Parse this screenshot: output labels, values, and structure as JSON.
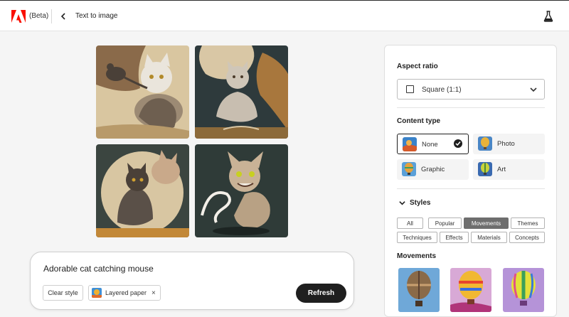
{
  "header": {
    "beta": "(Beta)",
    "breadcrumb": "Text to image",
    "brand_color": "#fa0f00"
  },
  "grid": {
    "images": [
      "cat-mouse-1",
      "cat-mouse-2",
      "cat-mouse-3",
      "cat-mouse-4"
    ]
  },
  "prompt": {
    "text": "Adorable cat catching mouse",
    "clear_label": "Clear style",
    "chip_label": "Layered paper",
    "chip_remove": "×",
    "refresh_label": "Refresh"
  },
  "panel": {
    "aspect_title": "Aspect ratio",
    "aspect_value": "Square (1:1)",
    "content_title": "Content type",
    "content_types": [
      {
        "label": "None",
        "selected": true
      },
      {
        "label": "Photo",
        "selected": false
      },
      {
        "label": "Graphic",
        "selected": false
      },
      {
        "label": "Art",
        "selected": false
      }
    ],
    "styles_title": "Styles",
    "style_tabs": [
      {
        "label": "All",
        "active": false
      },
      {
        "label": "Popular",
        "active": false
      },
      {
        "label": "Movements",
        "active": true
      },
      {
        "label": "Themes",
        "active": false
      },
      {
        "label": "Techniques",
        "active": false
      },
      {
        "label": "Effects",
        "active": false
      },
      {
        "label": "Materials",
        "active": false
      },
      {
        "label": "Concepts",
        "active": false
      }
    ],
    "movements_title": "Movements"
  }
}
